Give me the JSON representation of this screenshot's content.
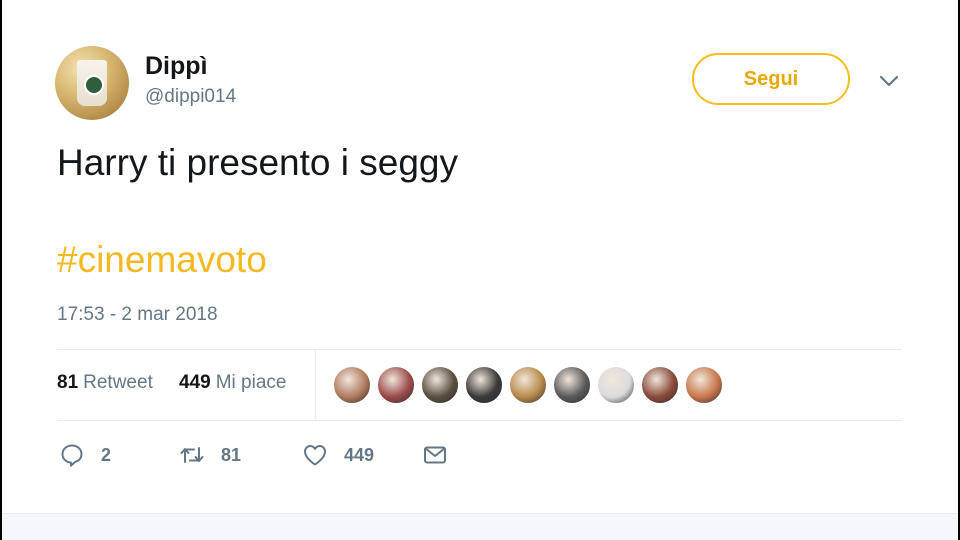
{
  "author": {
    "name": "Dippì",
    "handle": "@dippi014"
  },
  "follow_button": {
    "label": "Segui"
  },
  "tweet": {
    "text": "Harry ti presento i seggy",
    "hashtag": "#cinemavoto",
    "timestamp": "17:53 - 2 mar 2018"
  },
  "stats": {
    "retweets_count": "81",
    "retweets_label": "Retweet",
    "likes_count": "449",
    "likes_label": "Mi piace"
  },
  "likers": [
    {
      "color": "#b07a5e"
    },
    {
      "color": "#9b4a4a"
    },
    {
      "color": "#5a5040"
    },
    {
      "color": "#3a3a3a"
    },
    {
      "color": "#b88a4a"
    },
    {
      "color": "#5a5a5a"
    },
    {
      "color": "#dcdcdc"
    },
    {
      "color": "#8a4a3a"
    },
    {
      "color": "#c9774a"
    }
  ],
  "actions": {
    "reply_count": "2",
    "retweet_count": "81",
    "like_count": "449"
  },
  "icons": [
    "chevron-down-icon",
    "reply-icon",
    "retweet-icon",
    "like-icon",
    "message-icon"
  ],
  "colors": {
    "accent": "#f5bd1f",
    "text": "#14171a",
    "secondary_text": "#657786",
    "divider": "#e6ecf0"
  }
}
